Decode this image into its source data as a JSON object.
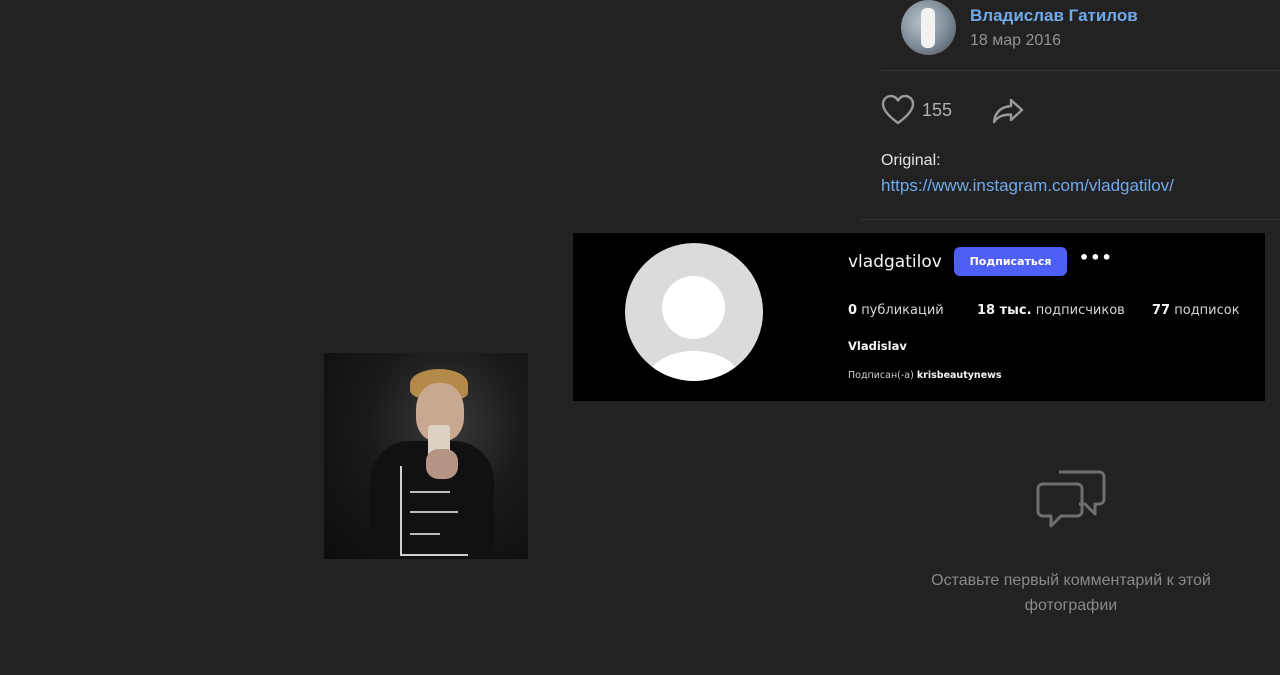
{
  "author": {
    "name": "Владислав Гатилов",
    "date": "18 мар 2016"
  },
  "actions": {
    "likes": "155",
    "like_icon": "heart-icon",
    "share_icon": "share-icon"
  },
  "description": {
    "label": "Original:",
    "link": "https://www.instagram.com/vladgatilov/"
  },
  "comments": {
    "empty_text": "Оставьте первый комментарий к этой фотографии",
    "icon": "comments-icon"
  },
  "instagram_card": {
    "username": "vladgatilov",
    "follow_label": "Подписаться",
    "more_label": "•••",
    "stats": [
      {
        "num": "0",
        "label": "публикаций"
      },
      {
        "num": "18 тыс.",
        "label": "подписчиков"
      },
      {
        "num": "77",
        "label": "подписок"
      }
    ],
    "full_name": "Vladislav",
    "followed_by_prefix": "Подписан(-а)",
    "followed_by_account": "krisbeautynews"
  },
  "colors": {
    "background": "#222222",
    "link": "#71aaeb",
    "follow_button": "#4e5ff7",
    "card_background": "#000000"
  }
}
